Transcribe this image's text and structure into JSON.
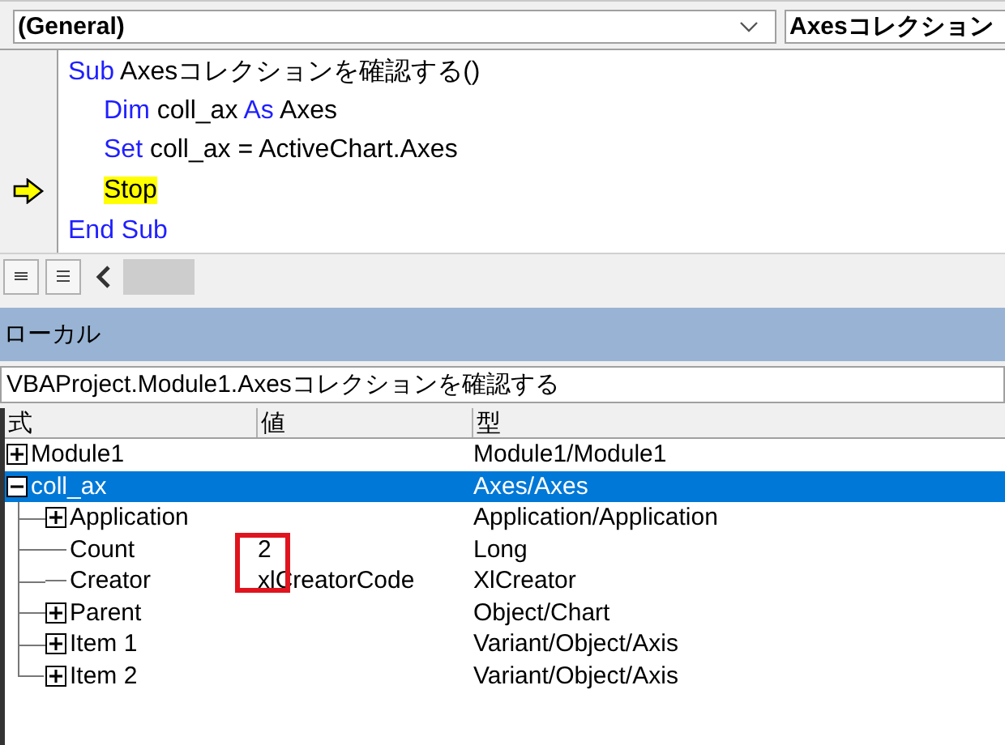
{
  "object_box": {
    "value": "(General)"
  },
  "procedure_box": {
    "value": "Axesコレクション"
  },
  "code": {
    "lines": [
      {
        "current": false,
        "segments": [
          {
            "kind": "keyword",
            "text": "Sub"
          },
          {
            "kind": "plain",
            "text": " Axesコレクションを確認する()"
          }
        ],
        "children": [
          {
            "current": false,
            "segments": [
              {
                "kind": "keyword",
                "text": "Dim"
              },
              {
                "kind": "plain",
                "text": " coll_ax "
              },
              {
                "kind": "keyword",
                "text": "As"
              },
              {
                "kind": "plain",
                "text": " Axes"
              }
            ]
          },
          {
            "current": false,
            "segments": [
              {
                "kind": "keyword",
                "text": "Set"
              },
              {
                "kind": "plain",
                "text": " coll_ax = ActiveChart.Axes"
              }
            ]
          },
          {
            "current": true,
            "segments": [
              {
                "kind": "plain",
                "text": "Stop"
              }
            ]
          }
        ]
      },
      {
        "current": false,
        "segments": [
          {
            "kind": "keyword",
            "text": "End Sub"
          }
        ]
      }
    ]
  },
  "locals": {
    "title": "ローカル",
    "context": "VBAProject.Module1.Axesコレクションを確認する",
    "columns": [
      "式",
      "値",
      "型"
    ],
    "rows": [
      {
        "expression": "Module1",
        "type": "Module1/Module1",
        "expandable": true,
        "expanded": false,
        "selected": false
      },
      {
        "expression": "coll_ax",
        "type": "Axes/Axes",
        "expandable": true,
        "expanded": true,
        "selected": true,
        "children": [
          {
            "expression": "Application",
            "type": "Application/Application",
            "expandable": true,
            "expanded": false,
            "selected": false
          },
          {
            "expression": "Count",
            "value": "2",
            "type": "Long",
            "expandable": false,
            "selected": false,
            "highlighted": true
          },
          {
            "expression": "Creator",
            "value": "xlCreatorCode",
            "type": "XlCreator",
            "expandable": false,
            "selected": false
          },
          {
            "expression": "Parent",
            "type": "Object/Chart",
            "expandable": true,
            "expanded": false,
            "selected": false
          },
          {
            "expression": "Item 1",
            "type": "Variant/Object/Axis",
            "expandable": true,
            "expanded": false,
            "selected": false
          },
          {
            "expression": "Item 2",
            "type": "Variant/Object/Axis",
            "expandable": true,
            "expanded": false,
            "selected": false
          }
        ]
      }
    ]
  }
}
